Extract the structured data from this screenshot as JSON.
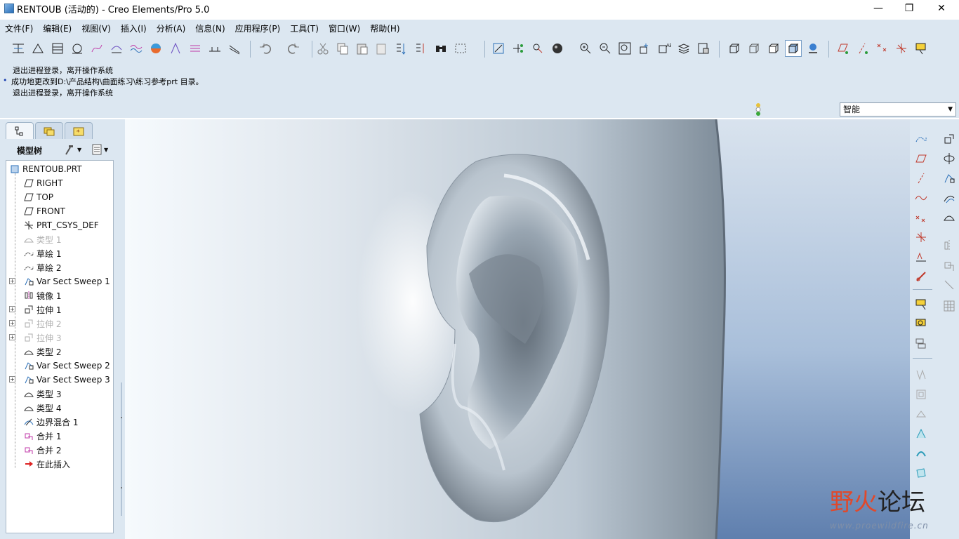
{
  "window": {
    "title": "RENTOUB (活动的) - Creo Elements/Pro 5.0",
    "minimize": "—",
    "maximize": "❐",
    "close": "✕"
  },
  "menu": [
    "文件(F)",
    "编辑(E)",
    "视图(V)",
    "插入(I)",
    "分析(A)",
    "信息(N)",
    "应用程序(P)",
    "工具(T)",
    "窗口(W)",
    "帮助(H)"
  ],
  "messages": [
    {
      "text": "退出进程登录，离开操作系统",
      "bullet": false
    },
    {
      "text": "成功地更改到D:\\产品结构\\曲面练习\\练习参考prt 目录。",
      "bullet": true
    },
    {
      "text": "退出进程登录，离开操作系统",
      "bullet": false
    }
  ],
  "selection_filter": {
    "value": "智能"
  },
  "model_tree": {
    "header": "模型树",
    "nodes": [
      {
        "label": "RENTOUB.PRT",
        "icon": "part-icon",
        "level": 0,
        "dim": false,
        "expander": false
      },
      {
        "label": "RIGHT",
        "icon": "datum-plane-icon",
        "level": 1,
        "dim": false,
        "expander": false
      },
      {
        "label": "TOP",
        "icon": "datum-plane-icon",
        "level": 1,
        "dim": false,
        "expander": false
      },
      {
        "label": "FRONT",
        "icon": "datum-plane-icon",
        "level": 1,
        "dim": false,
        "expander": false
      },
      {
        "label": "PRT_CSYS_DEF",
        "icon": "csys-icon",
        "level": 1,
        "dim": false,
        "expander": false
      },
      {
        "label": "类型 1",
        "icon": "surface-icon",
        "level": 1,
        "dim": true,
        "expander": false
      },
      {
        "label": "草绘 1",
        "icon": "sketch-icon",
        "level": 1,
        "dim": false,
        "expander": false
      },
      {
        "label": "草绘 2",
        "icon": "sketch-icon",
        "level": 1,
        "dim": false,
        "expander": false
      },
      {
        "label": "Var Sect Sweep 1",
        "icon": "sweep-icon",
        "level": 1,
        "dim": false,
        "expander": true
      },
      {
        "label": "镜像 1",
        "icon": "mirror-icon",
        "level": 1,
        "dim": false,
        "expander": false
      },
      {
        "label": "拉伸 1",
        "icon": "extrude-icon",
        "level": 1,
        "dim": false,
        "expander": true
      },
      {
        "label": "拉伸 2",
        "icon": "extrude-icon",
        "level": 1,
        "dim": true,
        "expander": true
      },
      {
        "label": "拉伸 3",
        "icon": "extrude-icon",
        "level": 1,
        "dim": true,
        "expander": true
      },
      {
        "label": "类型 2",
        "icon": "surface-icon",
        "level": 1,
        "dim": false,
        "expander": false
      },
      {
        "label": "Var Sect Sweep 2",
        "icon": "sweep-icon",
        "level": 1,
        "dim": false,
        "expander": false
      },
      {
        "label": "Var Sect Sweep 3",
        "icon": "sweep-icon",
        "level": 1,
        "dim": false,
        "expander": true
      },
      {
        "label": "类型 3",
        "icon": "surface-icon",
        "level": 1,
        "dim": false,
        "expander": false
      },
      {
        "label": "类型 4",
        "icon": "surface-icon",
        "level": 1,
        "dim": false,
        "expander": false
      },
      {
        "label": "边界混合 1",
        "icon": "boundary-blend-icon",
        "level": 1,
        "dim": false,
        "expander": false
      },
      {
        "label": "合并 1",
        "icon": "merge-icon",
        "level": 1,
        "dim": false,
        "expander": false
      },
      {
        "label": "合并 2",
        "icon": "merge-icon",
        "level": 1,
        "dim": false,
        "expander": false
      },
      {
        "label": "在此插入",
        "icon": "insert-here-arrow-icon",
        "level": 1,
        "dim": false,
        "expander": false
      }
    ]
  },
  "watermark": {
    "cn_left": "野火",
    "cn_right": "论坛",
    "url": "www.proewildfire.cn"
  },
  "colors": {
    "chrome": "#dce7f1",
    "accent": "#2a6fb8",
    "watermark_red": "#e0492b"
  }
}
